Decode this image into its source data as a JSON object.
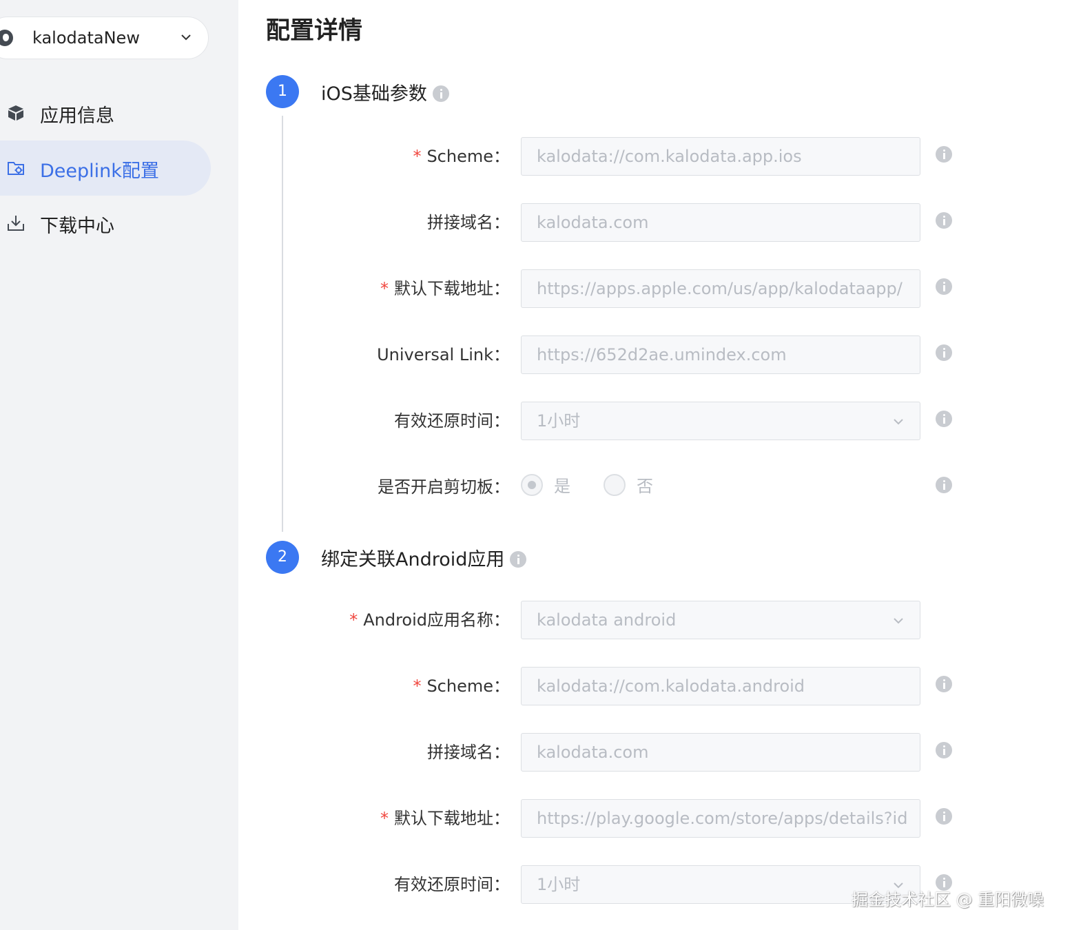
{
  "sidebar": {
    "app_selector": {
      "name": "kalodataNew",
      "icon": "apple-icon"
    },
    "items": [
      {
        "label": "应用信息",
        "icon": "cube-icon",
        "active": false
      },
      {
        "label": "Deeplink配置",
        "icon": "folder-settings-icon",
        "active": true
      },
      {
        "label": "下载中心",
        "icon": "download-icon",
        "active": false
      }
    ]
  },
  "main": {
    "title": "配置详情",
    "steps": [
      {
        "number": "1",
        "title": "iOS基础参数"
      },
      {
        "number": "2",
        "title": "绑定关联Android应用"
      }
    ],
    "ios": {
      "scheme_label": "Scheme",
      "scheme_value": "kalodata://com.kalodata.app.ios",
      "domain_label": "拼接域名",
      "domain_value": "kalodata.com",
      "download_label": "默认下载地址",
      "download_value": "https://apps.apple.com/us/app/kalodataapp/",
      "universal_label": "Universal Link",
      "universal_value": "https://652d2ae.umindex.com",
      "restore_label": "有效还原时间",
      "restore_value": "1小时",
      "clipboard_label": "是否开启剪切板",
      "clipboard_yes": "是",
      "clipboard_no": "否"
    },
    "android": {
      "app_name_label": "Android应用名称",
      "app_name_value": "kalodata android",
      "scheme_label": "Scheme",
      "scheme_value": "kalodata://com.kalodata.android",
      "domain_label": "拼接域名",
      "domain_value": "kalodata.com",
      "download_label": "默认下载地址",
      "download_value": "https://play.google.com/store/apps/details?id",
      "restore_label": "有效还原时间",
      "restore_value": "1小时"
    },
    "label_colon": "："
  },
  "watermark": "掘金技术社区 @ 重阳微噪",
  "colors": {
    "accent": "#3b78f2",
    "active_nav_text": "#3b6fe6",
    "active_nav_bg": "#e4e9f5",
    "required": "#f0473f",
    "sidebar_bg": "#f2f3f5"
  }
}
